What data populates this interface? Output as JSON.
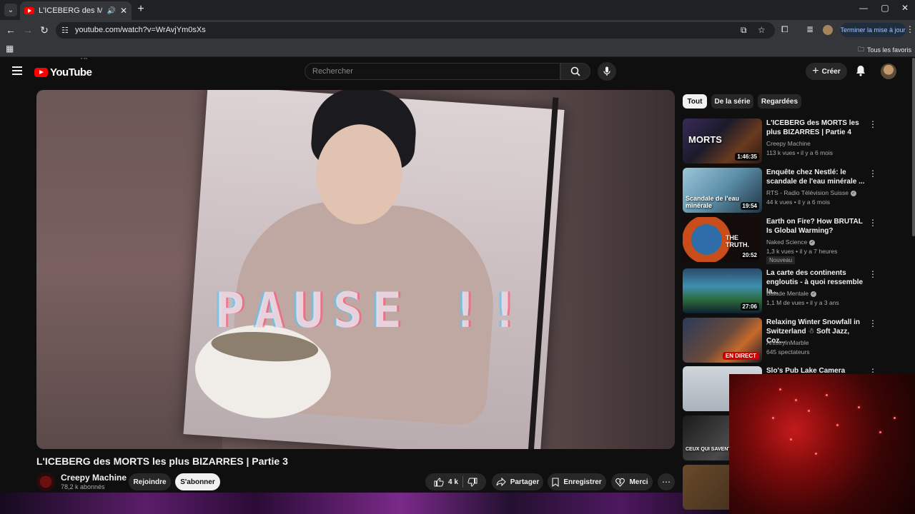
{
  "browser": {
    "tab_title": "L'ICEBERG des MORTS les p",
    "url": "youtube.com/watch?v=WrAvjYm0sXs",
    "update_button": "Terminer la mise à jour",
    "bookmarks_folder": "Tous les favoris"
  },
  "header": {
    "logo_text": "YouTube",
    "country": "FR",
    "search_placeholder": "Rechercher",
    "create_label": "Créer"
  },
  "player": {
    "overlay_text": "PAUSE !!"
  },
  "video": {
    "title": "L'ICEBERG des MORTS les plus BIZARRES | Partie 3",
    "channel_name": "Creepy Machine",
    "subscribers": "78,2 k abonnés",
    "join_label": "Rejoindre",
    "subscribe_label": "S'abonner",
    "likes": "4 k",
    "share_label": "Partager",
    "save_label": "Enregistrer",
    "thanks_label": "Merci"
  },
  "sidebar": {
    "chips": [
      "Tout",
      "De la série",
      "Regardées"
    ],
    "recommendations": [
      {
        "title": "L'ICEBERG des MORTS les plus BIZARRES | Partie 4",
        "channel": "Creepy Machine",
        "meta": "113 k vues • il y a 6 mois",
        "duration": "1:46:35",
        "thumb_text": "MORTS"
      },
      {
        "title": "Enquête chez Nestlé: le scandale de l'eau minérale ...",
        "channel": "RTS - Radio Télévision Suisse",
        "meta": "44 k vues • il y a 6 mois",
        "duration": "19:54",
        "thumb_text": "Scandale de l'eau minérale"
      },
      {
        "title": "Earth on Fire? How BRUTAL Is Global Warming?",
        "channel": "Naked Science",
        "meta": "1,3 k vues • il y a 7 heures",
        "duration": "20:52",
        "badge": "Nouveau",
        "thumb_text": "THE TRUTH."
      },
      {
        "title": "La carte des continents engloutis - à quoi ressemble la...",
        "channel": "Balade Mentale",
        "meta": "1,1 M de vues • il y a 3 ans",
        "duration": "27:06"
      },
      {
        "title": "Relaxing Winter Snowfall in Switzerland ☃ Soft Jazz, Coz...",
        "channel": "ArtistryInMarble",
        "meta": "645 spectateurs",
        "live": "EN DIRECT"
      },
      {
        "title": "Slo's Pub Lake Camera",
        "channel": "",
        "meta": ""
      },
      {
        "title": "",
        "channel": "",
        "meta": "",
        "thumb_text": "CEUX QUI SAVENT"
      },
      {
        "title": "",
        "channel": "",
        "meta": ""
      }
    ]
  }
}
